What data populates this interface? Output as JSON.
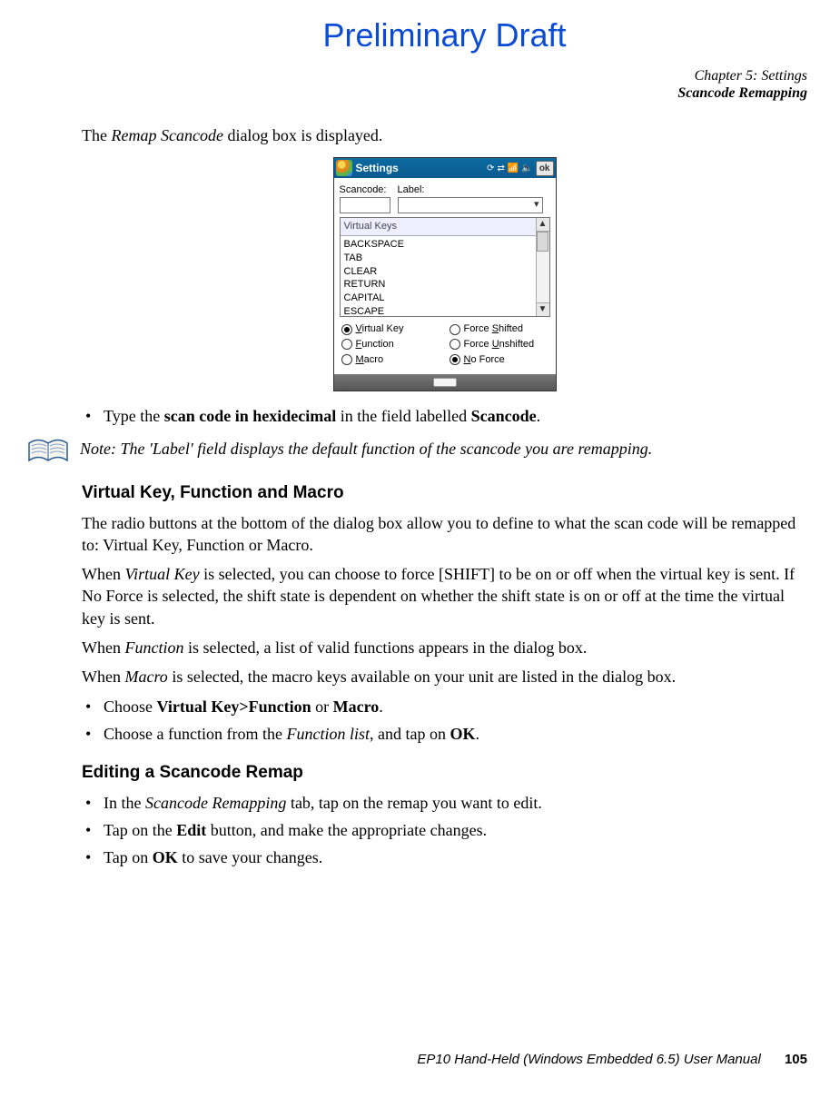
{
  "watermark": "Preliminary Draft",
  "header": {
    "chapter": "Chapter 5:  Settings",
    "section": "Scancode Remapping"
  },
  "intro_text_1": "The ",
  "intro_text_2": "Remap Scancode",
  "intro_text_3": " dialog box is displayed.",
  "device": {
    "title": "Settings",
    "ok": "ok",
    "scancode_label": "Scancode:",
    "label_label": "Label:",
    "list_header": "Virtual Keys",
    "list_items": [
      "BACKSPACE",
      "TAB",
      "CLEAR",
      "RETURN",
      "CAPITAL",
      "ESCAPE"
    ],
    "radios_left": [
      {
        "label": "Virtual Key",
        "checked": true
      },
      {
        "label": "Function",
        "checked": false
      },
      {
        "label": "Macro",
        "checked": false
      }
    ],
    "radios_right": [
      {
        "label": "Force Shifted",
        "checked": false
      },
      {
        "label": "Force Unshifted",
        "checked": false
      },
      {
        "label": "No Force",
        "checked": true
      }
    ]
  },
  "bullet_type_1": "Type the ",
  "bullet_type_2": "scan code in hexidecimal",
  "bullet_type_3": " in the field labelled ",
  "bullet_type_4": "Scancode",
  "bullet_type_5": ".",
  "note": {
    "label": "Note:",
    "text": "The 'Label' field displays the default function of the scancode you are remapping."
  },
  "subhead1": "Virtual Key, Function and Macro",
  "p1": "The radio buttons at the bottom of the dialog box allow you to define to what the scan code will be remapped to: Virtual Key, Function or Macro.",
  "p2a": "When ",
  "p2b": "Virtual Key",
  "p2c": " is selected, you can choose to force [SHIFT] to be on or off when the virtual key is sent. If No Force is selected, the shift state is dependent on whether the shift state is on or off at the time the virtual key is sent.",
  "p3a": "When ",
  "p3b": "Function",
  "p3c": " is selected, a list of valid functions appears in the dialog box.",
  "p4a": "When ",
  "p4b": "Macro",
  "p4c": " is selected, the macro keys available on your unit are listed in the dialog box.",
  "b2_1": "Choose ",
  "b2_2": "Virtual Key>Function",
  "b2_3": " or ",
  "b2_4": "Macro",
  "b2_5": ".",
  "b3_1": "Choose a function from the ",
  "b3_2": "Function list",
  "b3_3": ", and tap on ",
  "b3_4": "OK",
  "b3_5": ".",
  "subhead2": "Editing a Scancode Remap",
  "e1_1": "In the ",
  "e1_2": "Scancode Remapping",
  "e1_3": " tab, tap on the remap you want to edit.",
  "e2_1": "Tap on the ",
  "e2_2": "Edit",
  "e2_3": " button, and make the appropriate changes.",
  "e3_1": "Tap on ",
  "e3_2": "OK",
  "e3_3": " to save your changes.",
  "footer": {
    "title": "EP10 Hand-Held (Windows Embedded 6.5) User Manual",
    "page": "105"
  }
}
